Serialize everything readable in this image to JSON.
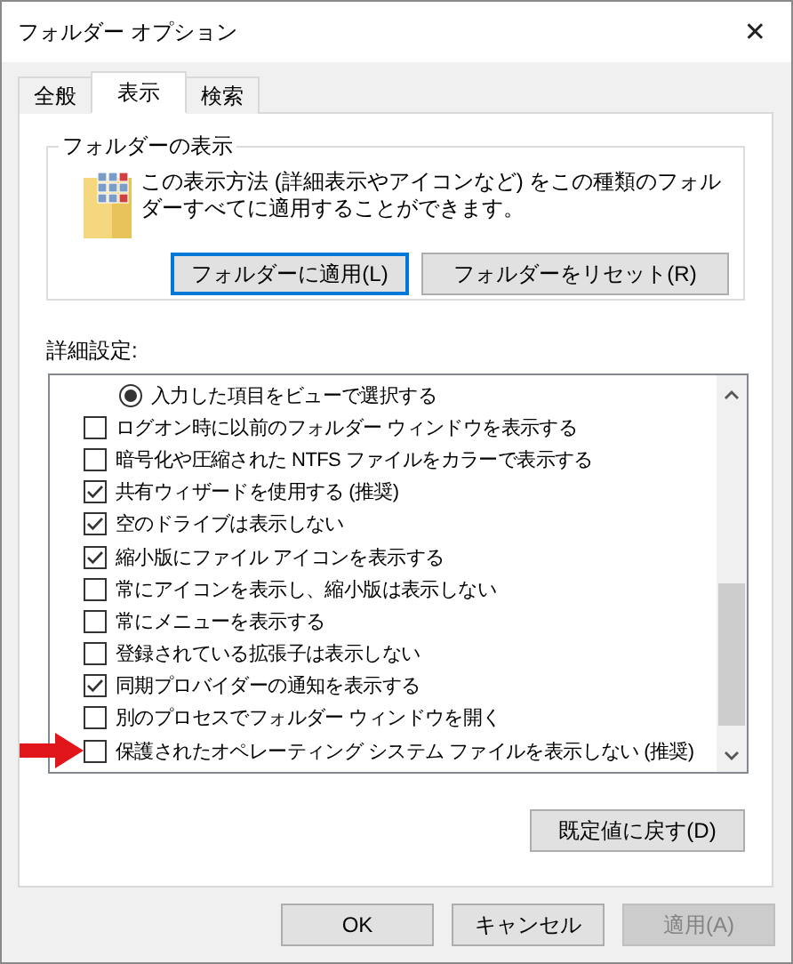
{
  "window": {
    "title": "フォルダー オプション",
    "close": "✕"
  },
  "tabs": [
    {
      "label": "全般",
      "selected": false
    },
    {
      "label": "表示",
      "selected": true
    },
    {
      "label": "検索",
      "selected": false
    }
  ],
  "folder_view": {
    "title": "フォルダーの表示",
    "description": "この表示方法 (詳細表示やアイコンなど) をこの種類のフォルダーすべてに適用することができます。",
    "buttons": [
      {
        "label": "フォルダーに適用(L)",
        "focused": true
      },
      {
        "label": "フォルダーをリセット(R)",
        "focused": false
      }
    ]
  },
  "advanced": {
    "label": "詳細設定:",
    "items": [
      {
        "kind": "radio",
        "label": "入力した項目をビューで選択する",
        "checked": true
      },
      {
        "kind": "checkbox",
        "label": "ログオン時に以前のフォルダー ウィンドウを表示する",
        "checked": false
      },
      {
        "kind": "checkbox",
        "label": "暗号化や圧縮された NTFS ファイルをカラーで表示する",
        "checked": false
      },
      {
        "kind": "checkbox",
        "label": "共有ウィザードを使用する (推奨)",
        "checked": true
      },
      {
        "kind": "checkbox",
        "label": "空のドライブは表示しない",
        "checked": true
      },
      {
        "kind": "checkbox",
        "label": "縮小版にファイル アイコンを表示する",
        "checked": true
      },
      {
        "kind": "checkbox",
        "label": "常にアイコンを表示し、縮小版は表示しない",
        "checked": false
      },
      {
        "kind": "checkbox",
        "label": "常にメニューを表示する",
        "checked": false
      },
      {
        "kind": "checkbox",
        "label": "登録されている拡張子は表示しない",
        "checked": false
      },
      {
        "kind": "checkbox",
        "label": "同期プロバイダーの通知を表示する",
        "checked": true
      },
      {
        "kind": "checkbox",
        "label": "別のプロセスでフォルダー ウィンドウを開く",
        "checked": false
      },
      {
        "kind": "checkbox",
        "label": "保護されたオペレーティング システム ファイルを表示しない (推奨)",
        "checked": false,
        "pointed": true
      }
    ],
    "restore_button": "既定値に戻す(D)"
  },
  "buttons": [
    {
      "label": "OK",
      "disabled": false
    },
    {
      "label": "キャンセル",
      "disabled": false
    },
    {
      "label": "適用(A)",
      "disabled": true
    }
  ]
}
